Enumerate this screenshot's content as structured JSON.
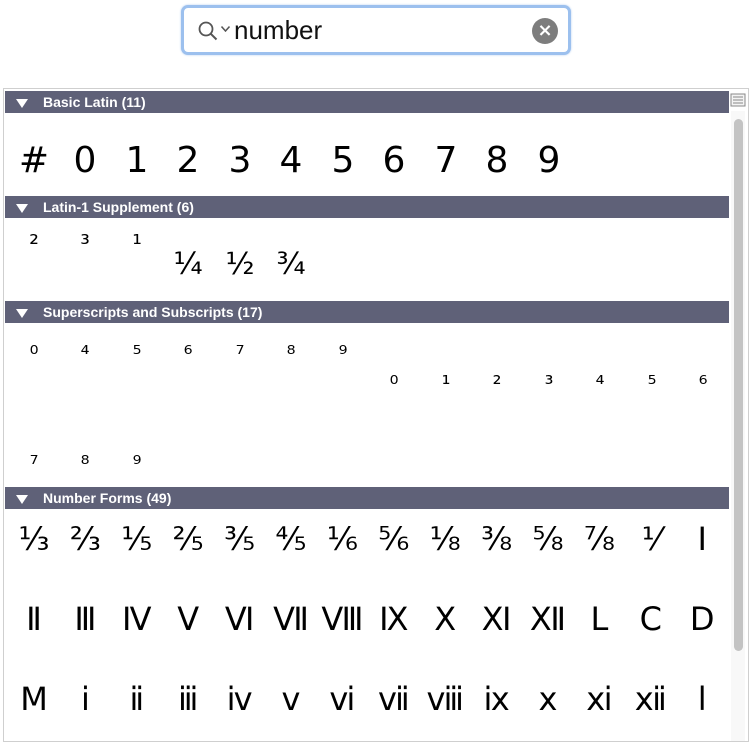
{
  "search": {
    "value": "number",
    "placeholder": ""
  },
  "sections": [
    {
      "title": "Basic Latin (11)",
      "glyphs": [
        "#",
        "0",
        "1",
        "2",
        "3",
        "4",
        "5",
        "6",
        "7",
        "8",
        "9"
      ]
    },
    {
      "title": "Latin-1 Supplement (6)",
      "glyphs": [
        "²",
        "³",
        "¹",
        "¼",
        "½",
        "¾"
      ]
    },
    {
      "title": "Superscripts and Subscripts (17)",
      "glyphs": [
        "⁰",
        "⁴",
        "⁵",
        "⁶",
        "⁷",
        "⁸",
        "⁹",
        "₀",
        "₁",
        "₂",
        "₃",
        "₄",
        "₅",
        "₆",
        "₇",
        "₈",
        "₉"
      ]
    },
    {
      "title": "Number Forms (49)",
      "glyphs": [
        "⅓",
        "⅔",
        "⅕",
        "⅖",
        "⅗",
        "⅘",
        "⅙",
        "⅚",
        "⅛",
        "⅜",
        "⅝",
        "⅞",
        "⅟",
        "Ⅰ",
        "Ⅱ",
        "Ⅲ",
        "Ⅳ",
        "Ⅴ",
        "Ⅵ",
        "Ⅶ",
        "Ⅷ",
        "Ⅸ",
        "Ⅹ",
        "Ⅺ",
        "Ⅻ",
        "Ⅼ",
        "Ⅽ",
        "Ⅾ",
        "Ⅿ",
        "ⅰ",
        "ⅱ",
        "ⅲ",
        "ⅳ",
        "ⅴ",
        "ⅵ",
        "ⅶ",
        "ⅷ",
        "ⅸ",
        "ⅹ",
        "ⅺ",
        "ⅻ",
        "ⅼ"
      ]
    }
  ],
  "icons": {
    "search": "search-icon",
    "dropdown": "chevron-down-icon",
    "clear": "clear-icon",
    "expand": "disclosure-triangle-icon"
  },
  "colors": {
    "header_bg": "#5f6178",
    "search_ring": "#9cc0ee"
  }
}
